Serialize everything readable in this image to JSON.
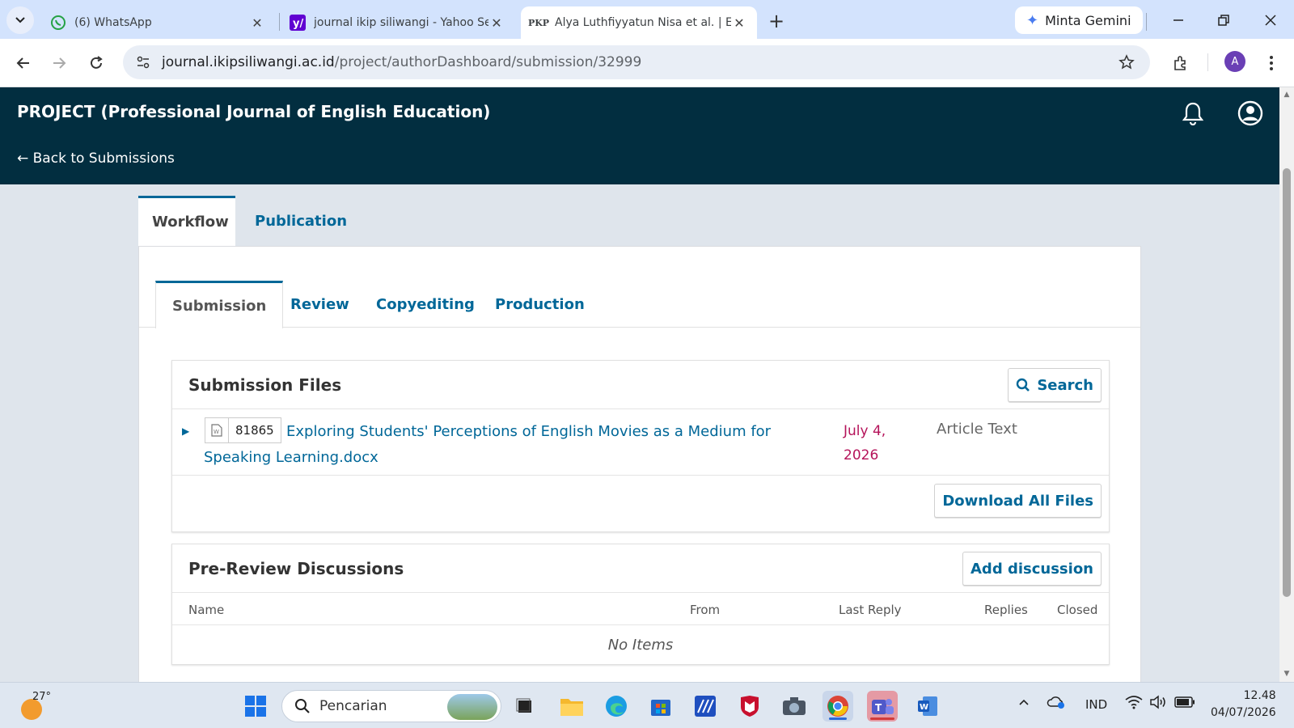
{
  "browser": {
    "tabs": [
      {
        "title": "(6) WhatsApp",
        "icon": "whatsapp-icon"
      },
      {
        "title": "journal ikip siliwangi - Yahoo Se",
        "icon": "yahoo-icon"
      },
      {
        "title": "Alya Luthfiyyatun Nisa et al. | Ex",
        "icon": "pkp-icon",
        "favicon_text": "PKP"
      }
    ],
    "gemini_label": "Minta Gemini",
    "url_host": "journal.ikipsiliwangi.ac.id",
    "url_path": "/project/authorDashboard/submission/32999",
    "profile_initial": "A"
  },
  "header": {
    "journal_title": "PROJECT (Professional Journal of English Education)",
    "back_link": "← Back to Submissions"
  },
  "main_tabs": [
    {
      "label": "Workflow",
      "active": true
    },
    {
      "label": "Publication",
      "active": false
    }
  ],
  "workflow_tabs": [
    {
      "label": "Submission",
      "active": true
    },
    {
      "label": "Review",
      "active": false
    },
    {
      "label": "Copyediting",
      "active": false
    },
    {
      "label": "Production",
      "active": false
    }
  ],
  "submission_files": {
    "title": "Submission Files",
    "search_label": "Search",
    "files": [
      {
        "id": "81865",
        "name": "Exploring Students' Perceptions of English Movies as a Medium for Speaking Learning.docx",
        "date": "July 4, 2026",
        "type": "Article Text"
      }
    ],
    "download_all_label": "Download All Files"
  },
  "discussions": {
    "title": "Pre-Review Discussions",
    "add_label": "Add discussion",
    "columns": [
      "Name",
      "From",
      "Last Reply",
      "Replies",
      "Closed"
    ],
    "empty_text": "No Items"
  },
  "taskbar": {
    "temperature": "27°",
    "search_placeholder": "Pencarian",
    "language": "IND",
    "time": "12.48",
    "date": "04/07/2026"
  },
  "colors": {
    "header_bg": "#022e40",
    "link": "#006798",
    "date_accent": "#b5135a"
  }
}
